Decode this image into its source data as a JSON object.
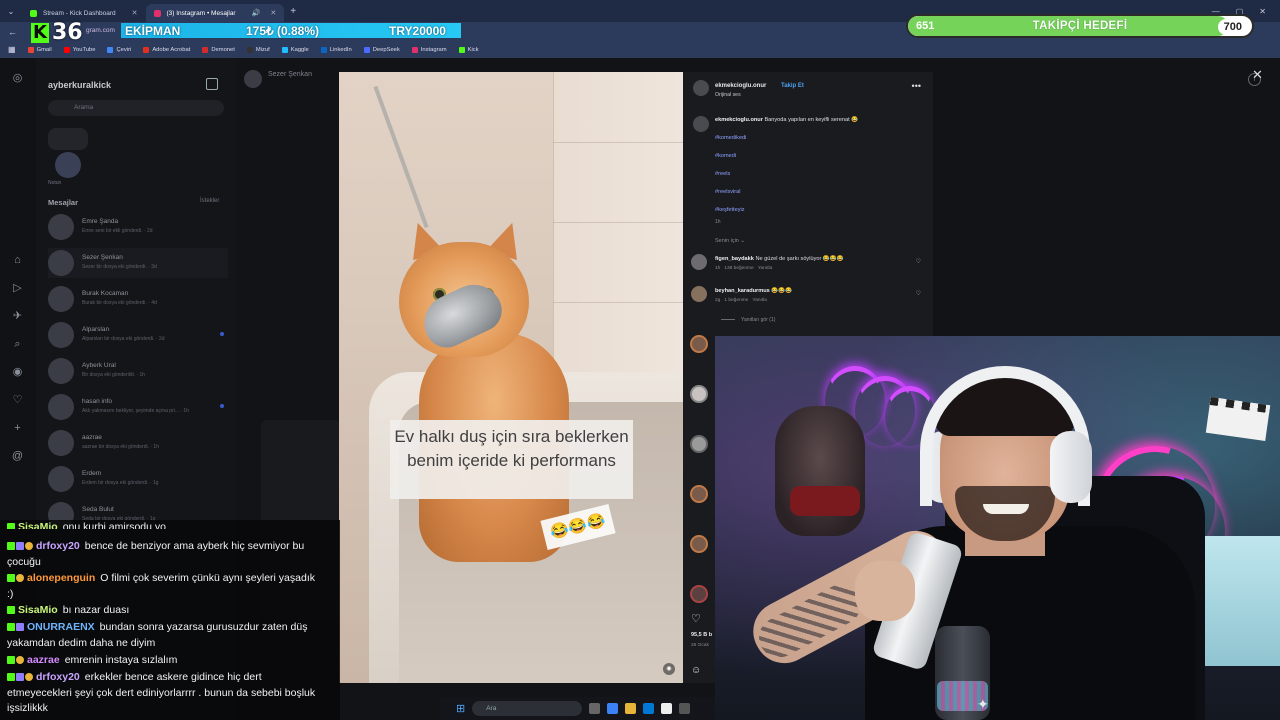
{
  "browser": {
    "tabs": [
      {
        "label": "Stream - Kick Dashboard",
        "color": "#53fc18"
      },
      {
        "label": "(3) Instagram • Mesajlar",
        "color": "#e1306c"
      }
    ],
    "url_fragment": "gram.com",
    "bookmarks": [
      {
        "label": "Gmail",
        "color": "#ea4335"
      },
      {
        "label": "YouTube",
        "color": "#ff0000"
      },
      {
        "label": "Çeviri",
        "color": "#4285f4"
      },
      {
        "label": "Adobe Acrobat",
        "color": "#e0301e"
      },
      {
        "label": "Demonet",
        "color": "#d12b2b"
      },
      {
        "label": "Mizuf",
        "color": "#333333"
      },
      {
        "label": "Kaggle",
        "color": "#20beff"
      },
      {
        "label": "LinkedIn",
        "color": "#0a66c2"
      },
      {
        "label": "DeepSeek",
        "color": "#4d6bfe"
      },
      {
        "label": "Instagram",
        "color": "#e1306c"
      },
      {
        "label": "Kick",
        "color": "#53fc18"
      }
    ]
  },
  "overlay": {
    "kick_count": "36",
    "ticker": {
      "label": "EKİPMAN",
      "value": "175₺ (0.88%)",
      "target": "TRY20000"
    },
    "goal": {
      "current": "651",
      "title": "TAKİPÇİ HEDEFİ",
      "target": "700",
      "progress": 0.93
    }
  },
  "instagram": {
    "inbox_user": "ayberkuralkick",
    "search_placeholder": "Arama",
    "note_label": "Notun",
    "messages_heading": "Mesajlar",
    "requests_label": "İstekler",
    "conversations": [
      {
        "name": "Emre Şanda",
        "preview": "Emre seni bir ekli gönderdi. · 2d",
        "unread": false
      },
      {
        "name": "Sezer Şenkan",
        "preview": "Sezer bir dosya eki gönderdi. · 3d",
        "unread": false
      },
      {
        "name": "Burak Kocaman",
        "preview": "Burak bir dosya eki gönderdi. · 4d",
        "unread": false
      },
      {
        "name": "Alparslan",
        "preview": "Alparslan bir dosya eki gönderdi. · 2d",
        "unread": true
      },
      {
        "name": "Ayberk Ural",
        "preview": "Bir dosya eki gönderildi. · 1h",
        "unread": false
      },
      {
        "name": "hasan info",
        "preview": "Aklı yakmasını bekliyor, şeyimde açma pri... · 1h",
        "unread": true
      },
      {
        "name": "aazrae",
        "preview": "aazrae bir dosya eki gönderdi. · 1h",
        "unread": false
      },
      {
        "name": "Erdem",
        "preview": "Erdem bir dosya eki gönderdi. · 1g",
        "unread": false
      },
      {
        "name": "Seda Bulut",
        "preview": "Seda bir dosya eki gönderdi. · 1g",
        "unread": false
      }
    ],
    "chat_header": "Sezer Şenkan"
  },
  "reel": {
    "video_caption": "Ev halkı duş için sıra beklerken benim içeride ki performans",
    "video_emoji": "😂😂😂",
    "author": "ekmekcioglu.onur",
    "follow": "Takip Et",
    "audio": "Orijinal ses",
    "caption_user": "ekmekcioglu.onur",
    "caption_text": "Banyoda yapılan en keyifli serenat 😂",
    "hashtags": [
      "#komedikedi",
      "#komedi",
      "#reels",
      "#reelsviral",
      "#keşfetteyiz"
    ],
    "caption_time": "1h",
    "for_you": "Senin için",
    "comments": [
      {
        "user": "figen_baydakk",
        "text": "Ne güzel de şarkı söylüyor 😂😂😂",
        "time": "1h",
        "likes": "138 beğenme",
        "reply": "Yanıtla"
      },
      {
        "user": "beyhan_karadurmus",
        "text": "😂😂😂",
        "time": "2g",
        "likes": "1 beğenme",
        "reply": "Yanıtla"
      }
    ],
    "view_replies": "Yanıtları gör (1)",
    "likes": "95,5 B b",
    "date": "26 Ocak"
  },
  "chat": {
    "messages": [
      {
        "user": "SisaMio",
        "user_color": "#c9f57a",
        "text": "onu kurbi amirsodu yo",
        "badges": [
          "k"
        ]
      },
      {
        "user": "drfoxy20",
        "user_color": "#c9a4ff",
        "text": "bence de benziyor ama ayberk hiç sevmiyor bu çocuğu",
        "badges": [
          "k",
          "sub",
          "gift"
        ]
      },
      {
        "user": "alonepenguin",
        "user_color": "#ff9a3a",
        "text": "O filmi çok severim çünkü aynı şeyleri yaşadık :)",
        "badges": [
          "k",
          "gift"
        ]
      },
      {
        "user": "SisaMio",
        "user_color": "#c9f57a",
        "text": "bı nazar duası",
        "badges": [
          "k"
        ]
      },
      {
        "user": "ONURRAENX",
        "user_color": "#6fb4ff",
        "text": "bundan sonra yazarsa gurusuzdur zaten düş yakamdan dedim daha ne diyim",
        "badges": [
          "k",
          "sub"
        ]
      },
      {
        "user": "aazrae",
        "user_color": "#d58bff",
        "text": "emrenin instaya sızlalım",
        "badges": [
          "k",
          "gift"
        ]
      },
      {
        "user": "drfoxy20",
        "user_color": "#c9a4ff",
        "text": "erkekler bence askere gidince hiç dert etmeyecekleri şeyi çok dert ediniyorlarrrr . bunun da sebebi boşluk işsizlikkk",
        "badges": [
          "k",
          "sub",
          "gift"
        ]
      }
    ]
  },
  "taskbar": {
    "search": "Ara"
  }
}
